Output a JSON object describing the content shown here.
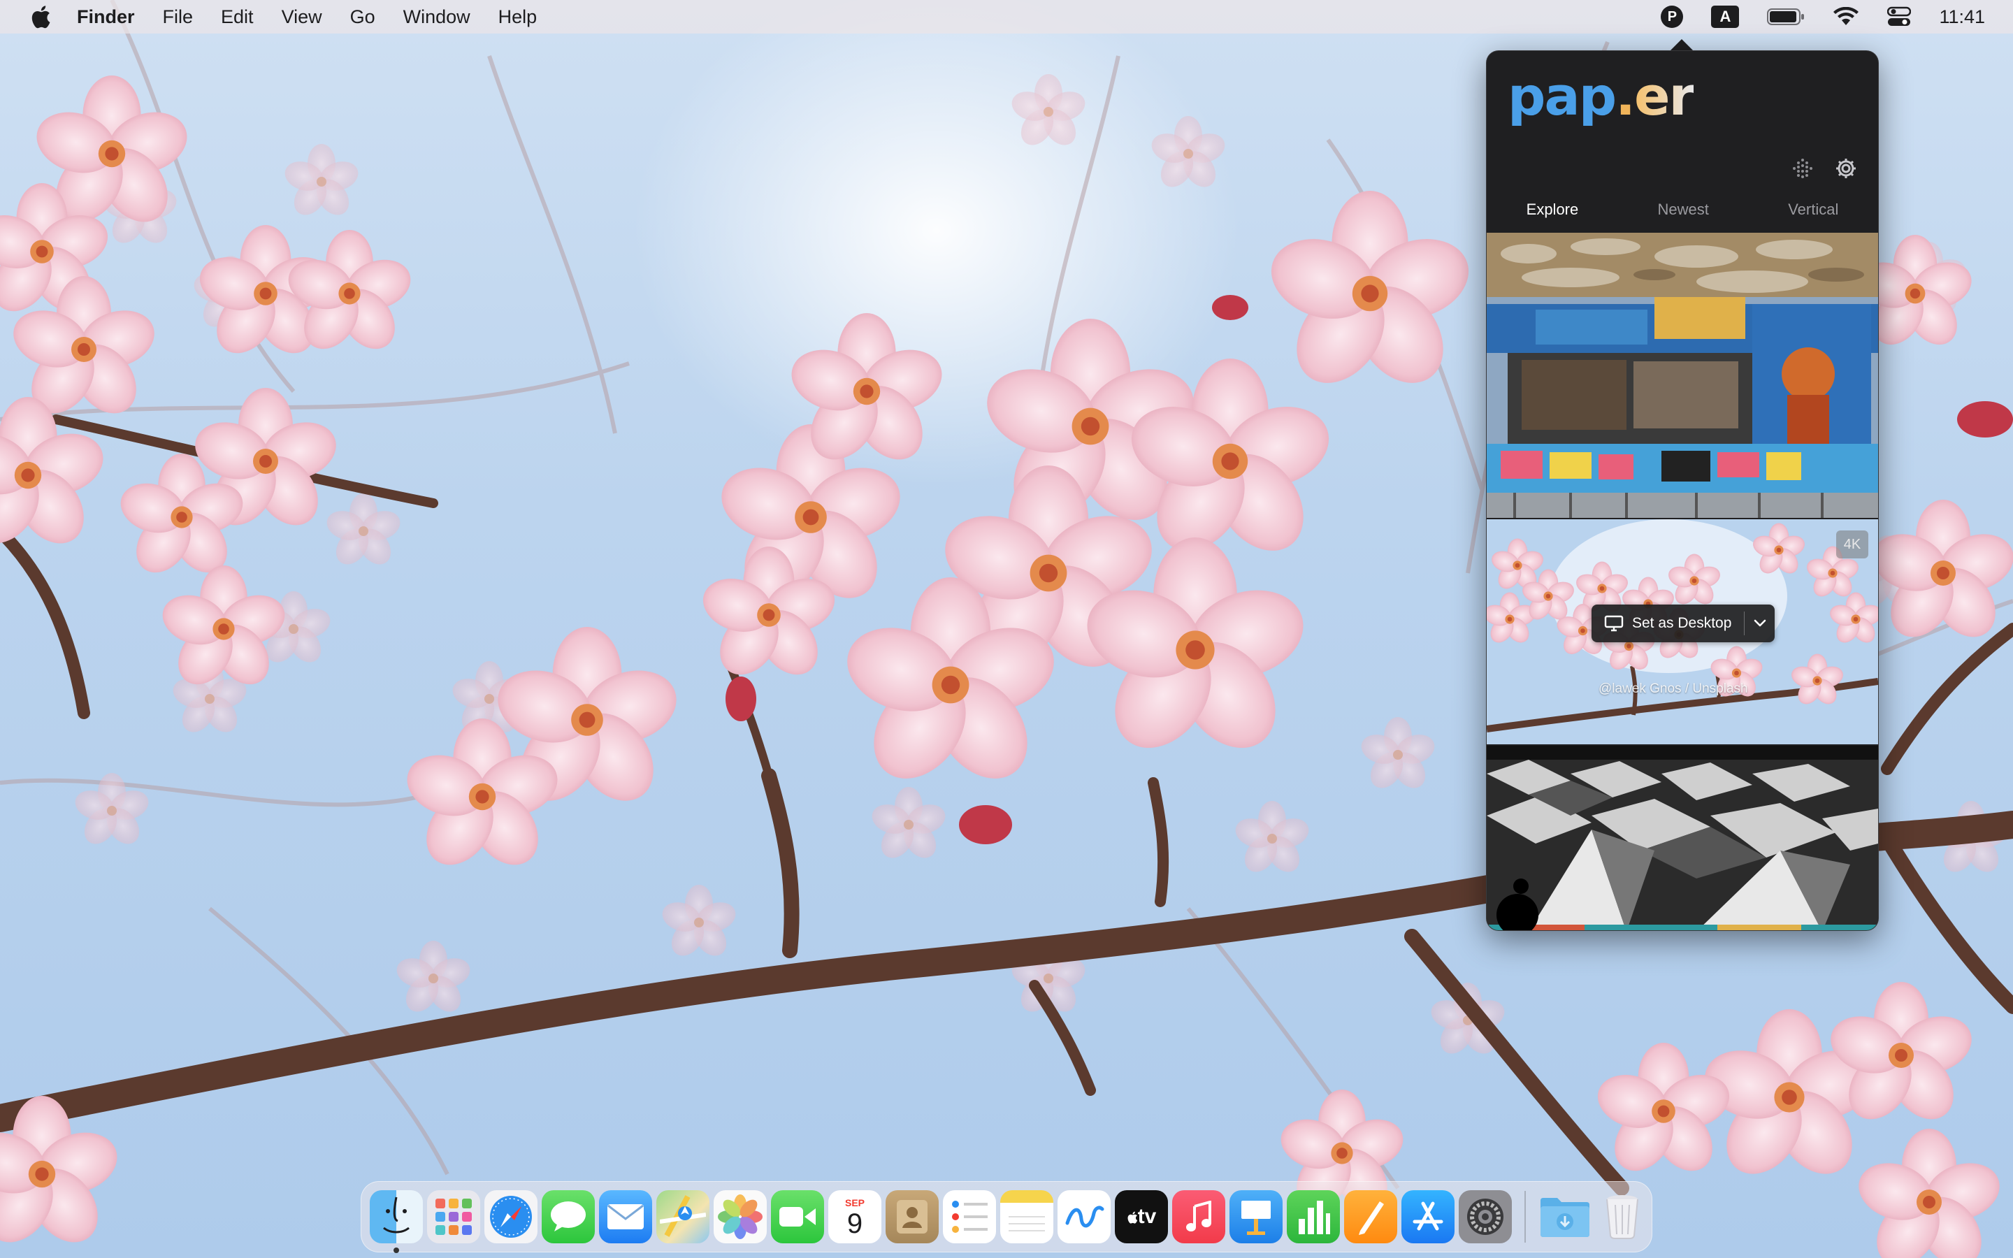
{
  "menubar": {
    "apple_icon": "apple-logo-icon",
    "app_name": "Finder",
    "menus": [
      "File",
      "Edit",
      "View",
      "Go",
      "Window",
      "Help"
    ],
    "status": {
      "paper_badge": "P",
      "input_source": "A",
      "battery_icon": "battery-icon",
      "wifi_icon": "wifi-icon",
      "control_center_icon": "control-center-icon",
      "clock": "11:41"
    }
  },
  "popover": {
    "logo": {
      "part1": "pap",
      "dot": ".",
      "part2": "er"
    },
    "header_buttons": [
      "sparkle-grid-icon",
      "gear-icon"
    ],
    "tabs": [
      {
        "label": "Explore",
        "active": true
      },
      {
        "label": "Newest",
        "active": false
      },
      {
        "label": "Vertical",
        "active": false
      }
    ],
    "gallery": {
      "featured": {
        "resolution_badge": "4K",
        "action_label": "Set as Desktop",
        "credit": "@lawek Gnos / Unsplash"
      }
    }
  },
  "dock": {
    "apps": [
      {
        "name": "Finder",
        "running": true
      },
      {
        "name": "Launchpad"
      },
      {
        "name": "Safari"
      },
      {
        "name": "Messages"
      },
      {
        "name": "Mail"
      },
      {
        "name": "Maps"
      },
      {
        "name": "Photos"
      },
      {
        "name": "FaceTime"
      },
      {
        "name": "Calendar",
        "month": "SEP",
        "day": "9"
      },
      {
        "name": "Contacts"
      },
      {
        "name": "Reminders"
      },
      {
        "name": "Notes"
      },
      {
        "name": "Freeform"
      },
      {
        "name": "TV",
        "label": "tv"
      },
      {
        "name": "Music"
      },
      {
        "name": "Keynote"
      },
      {
        "name": "Numbers"
      },
      {
        "name": "Pages"
      },
      {
        "name": "App Store"
      },
      {
        "name": "System Settings"
      }
    ],
    "right": [
      {
        "name": "Downloads"
      },
      {
        "name": "Trash"
      }
    ]
  }
}
